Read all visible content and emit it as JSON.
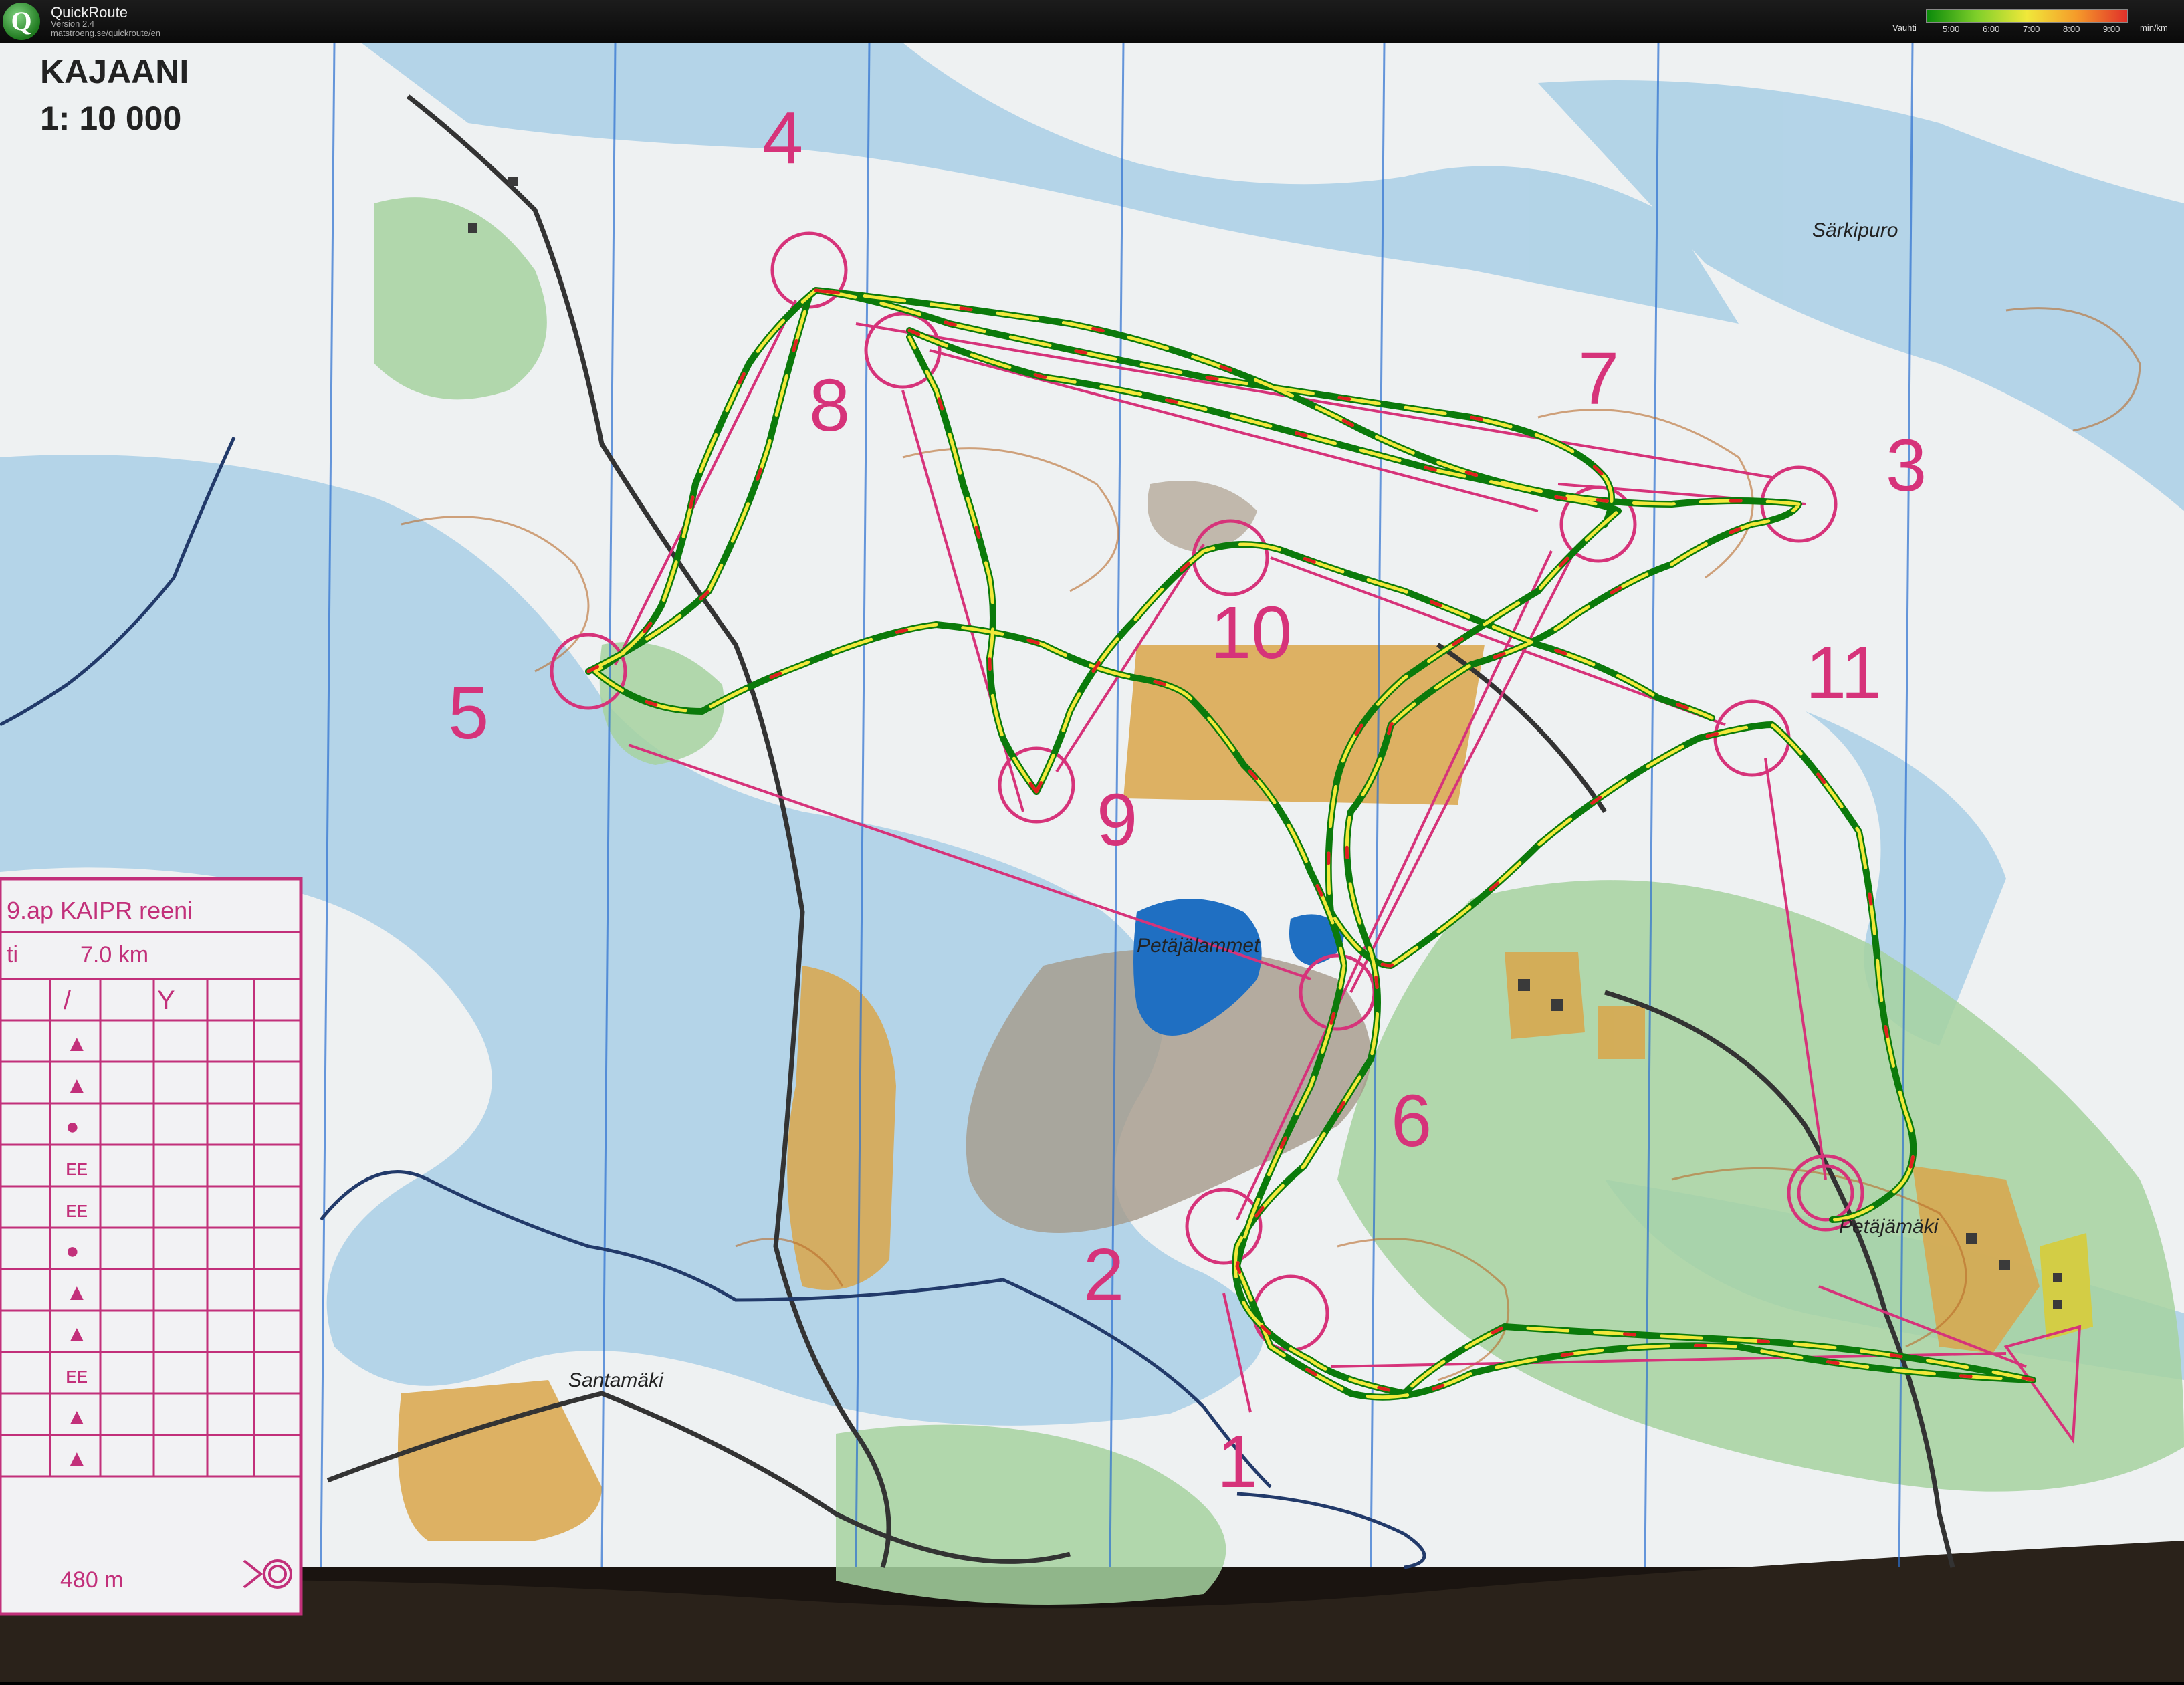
{
  "app": {
    "title": "QuickRoute",
    "version": "Version 2.4",
    "url": "matstroeng.se/quickroute/en",
    "logo_letter": "Q"
  },
  "legend": {
    "label": "Vauhti",
    "unit": "min/km",
    "ticks": [
      "5:00",
      "6:00",
      "7:00",
      "8:00",
      "9:00"
    ],
    "colors": [
      "#0a8a0a",
      "#7fcf2a",
      "#f0e83a",
      "#f59a2a",
      "#e0302a"
    ]
  },
  "map": {
    "title": "KAJAANI",
    "scale": "1: 10 000",
    "place_names": [
      "Särkipuro",
      "Petäjälammet",
      "Petäjämäki",
      "Santamäki"
    ],
    "controls": [
      "1",
      "2",
      "3",
      "4",
      "5",
      "6",
      "7",
      "8",
      "9",
      "10",
      "11"
    ],
    "control_colors": {
      "course": "#d6337a",
      "route_green": "#0b7a0b",
      "route_yellow": "#f2e83a",
      "route_red": "#e02020"
    }
  },
  "course_card": {
    "title": "9.ap KAIPR reeni",
    "col_left": "ti",
    "distance": "7.0 km",
    "header_symbols": [
      "/",
      "Y"
    ],
    "rows": [
      "▲",
      "▲",
      "●",
      "ᴇᴇ",
      "ᴇᴇ",
      "●",
      "▲",
      "▲",
      "ᴇᴇ",
      "▲",
      "▲"
    ],
    "footer": "480 m"
  }
}
